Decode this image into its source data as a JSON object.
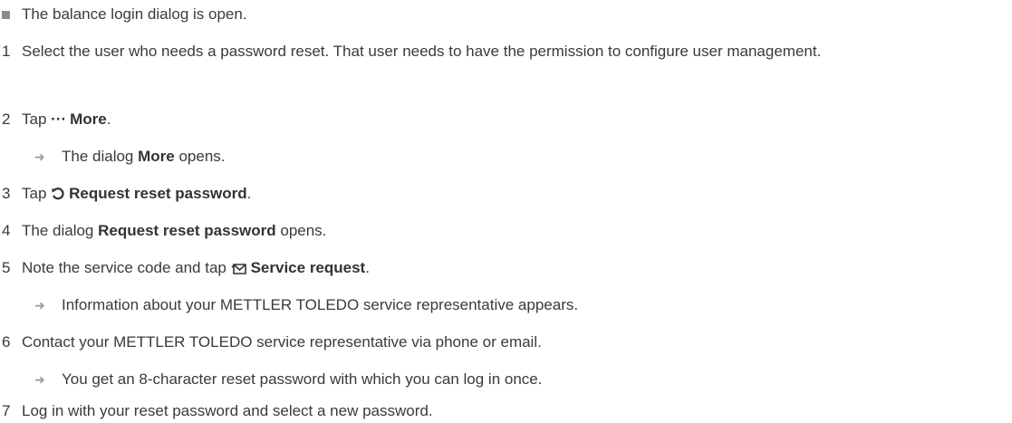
{
  "prerequisite": "The balance login dialog is open.",
  "steps": [
    {
      "num": "1",
      "text": "Select the user who needs a password reset. That user needs to have the permission to configure user management."
    },
    {
      "num": "2",
      "pre": "Tap ",
      "bold": "More",
      "post": "."
    },
    {
      "result_pre": "The dialog ",
      "result_bold": "More",
      "result_post": " opens."
    },
    {
      "num": "3",
      "pre": "Tap ",
      "bold": "Request reset password",
      "post": "."
    },
    {
      "num": "4",
      "pre": "The dialog ",
      "bold": "Request reset password",
      "post": " opens."
    },
    {
      "num": "5",
      "pre": "Note the service code and tap ",
      "bold": "Service request",
      "post": "."
    },
    {
      "result": "Information about your METTLER TOLEDO service representative appears."
    },
    {
      "num": "6",
      "text": "Contact your METTLER TOLEDO service representative via phone or email."
    },
    {
      "result": "You get an 8-character reset password with which you can log in once."
    },
    {
      "num": "7",
      "text": "Log in with your reset password and select a new password."
    }
  ],
  "icons": {
    "more": "more-icon",
    "reset": "reset-arrow-icon",
    "service": "envelope-icon"
  }
}
